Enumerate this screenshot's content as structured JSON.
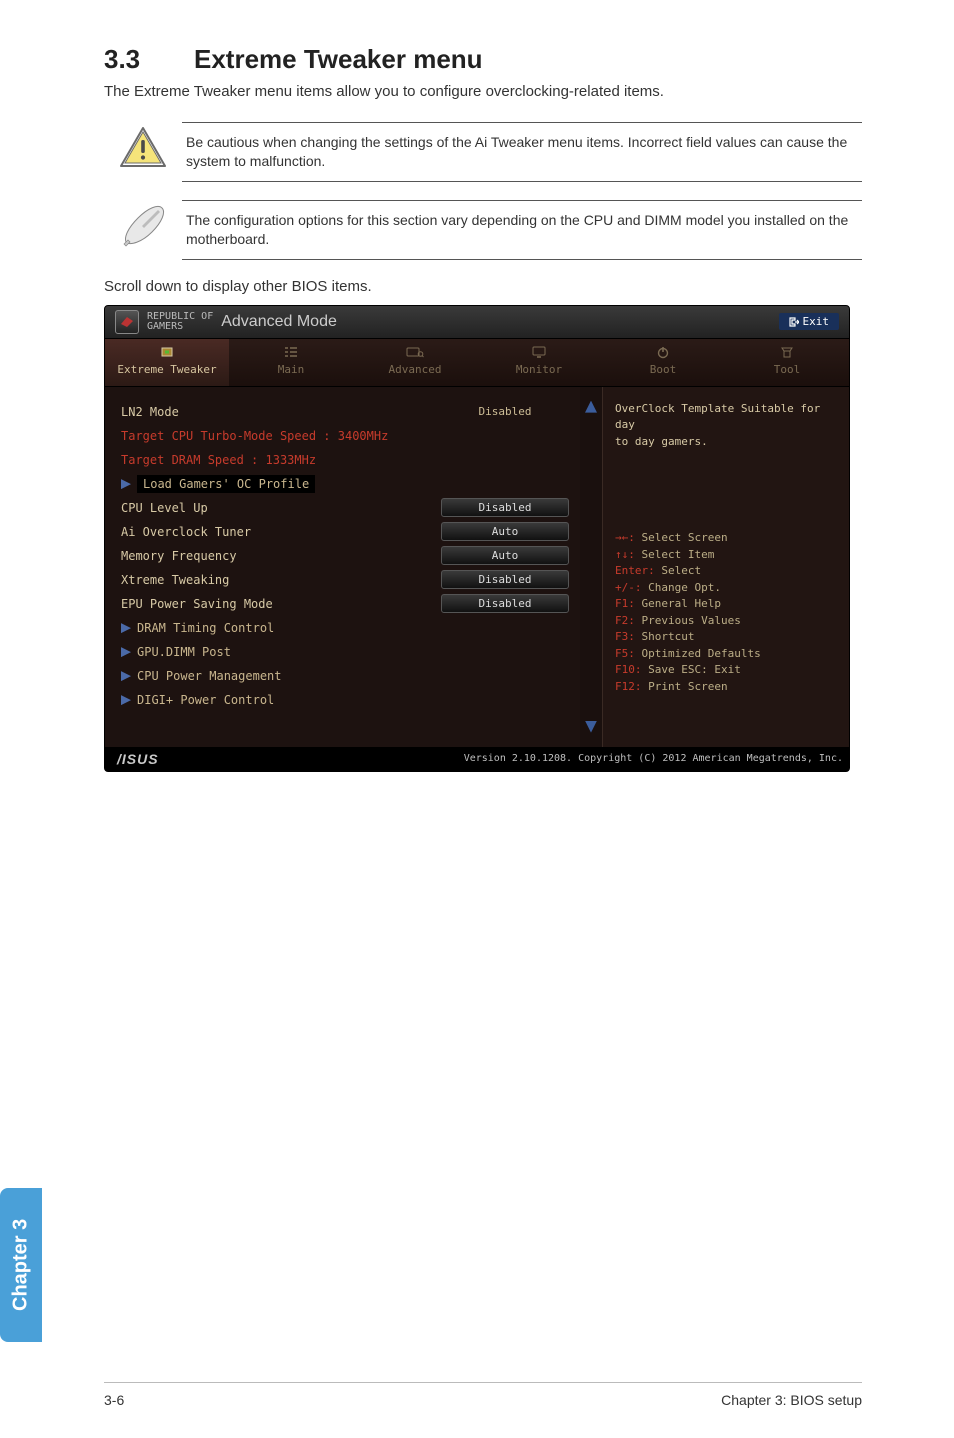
{
  "section": {
    "number": "3.3",
    "title": "Extreme Tweaker menu",
    "lead": "The Extreme Tweaker menu items allow you to configure overclocking-related items."
  },
  "callouts": {
    "caution": "Be cautious when changing the settings of the Ai Tweaker menu items. Incorrect field values can cause the system to malfunction.",
    "note": "The configuration options for this section vary depending on the CPU and DIMM model you installed on the motherboard."
  },
  "scroll_note": "Scroll down to display other BIOS items.",
  "bios": {
    "brand_small": "REPUBLIC OF",
    "brand_small2": "GAMERS",
    "mode": "Advanced Mode",
    "exit": "Exit",
    "tabs": {
      "extreme": "Extreme Tweaker",
      "main": "Main",
      "advanced": "Advanced",
      "monitor": "Monitor",
      "boot": "Boot",
      "tool": "Tool"
    },
    "rows": {
      "lnmode": {
        "label": "LN2 Mode",
        "value": "Disabled"
      },
      "target_cpu": "Target CPU Turbo-Mode Speed : 3400MHz",
      "target_dram": "Target DRAM Speed : 1333MHz",
      "load_profile": "Load Gamers' OC Profile",
      "cpu_level": {
        "label": "CPU Level Up",
        "value": "Disabled"
      },
      "ai_tuner": {
        "label": "Ai Overclock Tuner",
        "value": "Auto"
      },
      "mem_freq": {
        "label": "Memory Frequency",
        "value": "Auto"
      },
      "xtreme": {
        "label": "Xtreme Tweaking",
        "value": "Disabled"
      },
      "epu": {
        "label": "EPU Power Saving Mode",
        "value": "Disabled"
      },
      "dram_timing": "DRAM Timing Control",
      "gpu_post": "GPU.DIMM Post",
      "cpu_pm": "CPU Power Management",
      "digi": "DIGI+ Power Control"
    },
    "right": {
      "desc1": "OverClock Template Suitable for day",
      "desc2": "to day gamers.",
      "help": {
        "select_screen": {
          "k": "→←:",
          "v": "Select Screen"
        },
        "select_item": {
          "k": "↑↓:",
          "v": "Select Item"
        },
        "enter": {
          "k": "Enter:",
          "v": "Select"
        },
        "change": {
          "k": "+/-:",
          "v": "Change Opt."
        },
        "f1": {
          "k": "F1:",
          "v": "General Help"
        },
        "f2": {
          "k": "F2:",
          "v": "Previous Values"
        },
        "f3": {
          "k": "F3:",
          "v": "Shortcut"
        },
        "f5": {
          "k": "F5:",
          "v": "Optimized Defaults"
        },
        "f10": {
          "k": "F10:",
          "v": "Save   ESC: Exit"
        },
        "f12": {
          "k": "F12:",
          "v": "Print Screen"
        }
      }
    },
    "footer": {
      "asus": "/ISUS",
      "text": "Version 2.10.1208. Copyright (C) 2012 American Megatrends, Inc."
    }
  },
  "chapter_tab": "Chapter 3",
  "footer": {
    "left": "3-6",
    "right": "Chapter 3: BIOS setup"
  }
}
